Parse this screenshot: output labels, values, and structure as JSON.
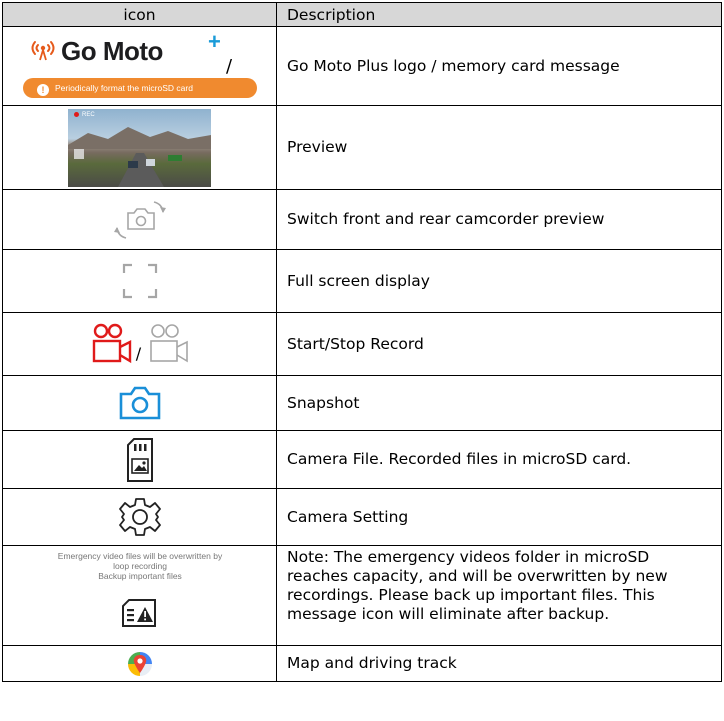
{
  "header": {
    "icon_col": "icon",
    "description_col": "Description"
  },
  "rows": [
    {
      "icon": "go-moto-plus-logo-and-format-message",
      "logo_text": "Go Moto",
      "logo_plus": "+",
      "separator": "/",
      "card_message": "Periodically format the microSD card",
      "description": "Go Moto Plus logo / memory card message"
    },
    {
      "icon": "preview-image",
      "rec_label": "REC",
      "description": "Preview"
    },
    {
      "icon": "switch-camera-icon",
      "description": "Switch front and rear camcorder preview"
    },
    {
      "icon": "fullscreen-icon",
      "description": "Full screen display"
    },
    {
      "icon": "record-icon",
      "separator": "/",
      "description": "Start/Stop Record"
    },
    {
      "icon": "camera-icon",
      "description": "Snapshot"
    },
    {
      "icon": "sd-card-file-icon",
      "description": "Camera File. Recorded files in microSD card."
    },
    {
      "icon": "gear-icon",
      "description": "Camera Setting"
    },
    {
      "icon": "emergency-folder-warning-icon",
      "note_line1": "Emergency video files will be overwritten by",
      "note_line2": "loop recording",
      "note_line3": "Backup important files",
      "description": "Note: The emergency videos folder in microSD reaches capacity, and will be overwritten by new recordings. Please back up important files. This message icon will eliminate after backup."
    },
    {
      "icon": "map-pin-icon",
      "description": "Map and driving track"
    }
  ],
  "colors": {
    "header_bg": "#d7d7d7",
    "record_active": "#e01a1a",
    "snapshot_blue": "#1a8fd8",
    "icon_gray": "#a6a6a6",
    "message_orange": "#f08a2f"
  }
}
